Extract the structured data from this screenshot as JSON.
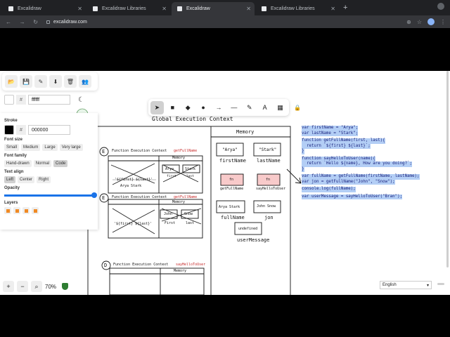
{
  "browser": {
    "tabs": [
      {
        "title": "Excalidraw",
        "active": false
      },
      {
        "title": "Excalidraw Libraries",
        "active": false
      },
      {
        "title": "Excalidraw",
        "active": true
      },
      {
        "title": "Excalidraw Libraries",
        "active": false
      }
    ],
    "new_tab": "+",
    "url": "excalidraw.com"
  },
  "left_panel": {
    "bg_hex": "ffffff",
    "stroke_label": "Stroke",
    "stroke_hex": "000000",
    "hash": "#",
    "font_size_label": "Font size",
    "font_sizes": [
      "Small",
      "Medium",
      "Large",
      "Very large"
    ],
    "font_family_label": "Font family",
    "font_families": [
      "Hand-drawn",
      "Normal",
      "Code"
    ],
    "text_align_label": "Text align",
    "aligns": [
      "Left",
      "Center",
      "Right"
    ],
    "opacity_label": "Opacity",
    "opacity_value": 1.0,
    "layers_label": "Layers"
  },
  "footer": {
    "zoom": "70%",
    "language": "English"
  },
  "canvas": {
    "gec_title": "Global Execution Context",
    "memory_label": "Memory",
    "fec_title": "Function Execution Context",
    "fn_getFullName": "getFullName",
    "fn_sayHello": "sayHelloToUser",
    "marker_e": "E",
    "marker_d": "D",
    "tmpl": "'${first} ${last}'",
    "arya_stark": "Arya Stark",
    "arya_q": "\"Arya\"",
    "stark_q": "\"Stark\"",
    "first": "first",
    "last": "last",
    "firstName": "firstName",
    "lastName": "lastName",
    "fn_box": "fn",
    "getFullName_lbl": "getFullName",
    "sayHelloToUser_lbl": "sayHelloToUser",
    "arya": "Arya",
    "stark": "Stark",
    "john": "John",
    "snow": "Snow",
    "fullName": "fullName",
    "john_snow": "John Snow",
    "jon": "jon",
    "undefined": "undefined",
    "userMessage": "userMessage",
    "first_cap": "First",
    "code_lines": [
      "var firstName = \"Arya\";",
      "var lastName = \"Stark\";",
      "",
      "function getFullName(first, last){",
      "  return `${first} ${last}`;",
      "}",
      "",
      "function sayHelloToUser(name){",
      "  return `Hello ${name}, How are you doing?`;",
      "}",
      "",
      "var fullName = getFullName(firstName, lastName);",
      "var jon = getFullName(\"John\", \"Snow\");",
      "",
      "console.log(fullName);",
      "",
      "var userMessage = sayHelloToUser(\"Bran\");"
    ]
  }
}
